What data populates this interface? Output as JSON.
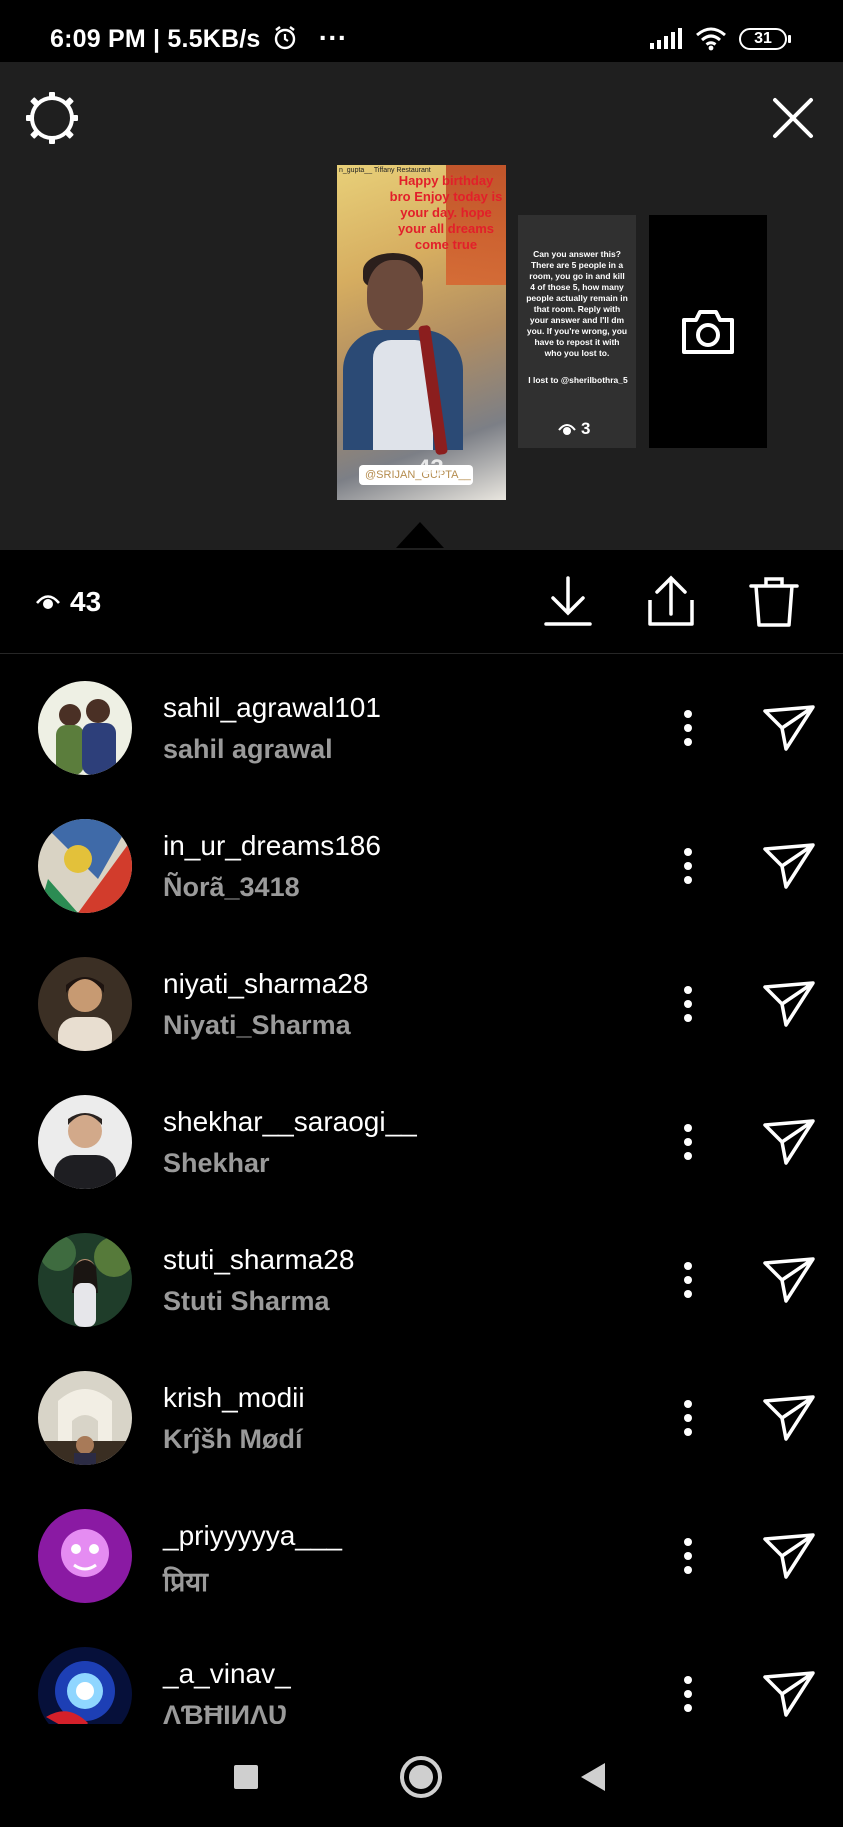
{
  "status_bar": {
    "time": "6:09 PM | 5.5KB/s",
    "overflow": "···",
    "battery": "31"
  },
  "preview": {
    "main_thumb": {
      "caption": "Happy birthday bro Enjoy today is your day. hope your all dreams come true",
      "tag": "n_gupta__ Tiffany Restaurant",
      "mention": "@SRIJAN_GUPTA__",
      "views": "43"
    },
    "quiz_thumb": {
      "text": "Can you answer this? There are 5 people in a room, you go in and kill 4 of those 5, how many people actually remain in that room. Reply with your answer and I'll dm you. If you're wrong, you have to repost it with who you lost to.",
      "lost": "I lost to @sherilbothra_5",
      "views": "3"
    }
  },
  "action_bar": {
    "views": "43"
  },
  "viewers": [
    {
      "username": "sahil_agrawal101",
      "name": "sahil agrawal",
      "avatar_color": "#6d7a3f"
    },
    {
      "username": "in_ur_dreams186",
      "name": "Ñorã_3418",
      "avatar_color": "#3f6aa8"
    },
    {
      "username": "niyati_sharma28",
      "name": "Niyati_Sharma",
      "avatar_color": "#8a6a4a"
    },
    {
      "username": "shekhar__saraogi__",
      "name": "Shekhar",
      "avatar_color": "#c9c9c9"
    },
    {
      "username": "stuti_sharma28",
      "name": "Stuti Sharma",
      "avatar_color": "#2f5a3a"
    },
    {
      "username": "krish_modii",
      "name": "Krĵšh Mødí",
      "avatar_color": "#b89a5a"
    },
    {
      "username": "_priyyyyya___",
      "name": "प्रिया",
      "avatar_color": "#a01fb8"
    },
    {
      "username": "_a_vinav_",
      "name": "ΛƁĦIИΛƲ",
      "avatar_color": "#1d3fb5"
    }
  ]
}
